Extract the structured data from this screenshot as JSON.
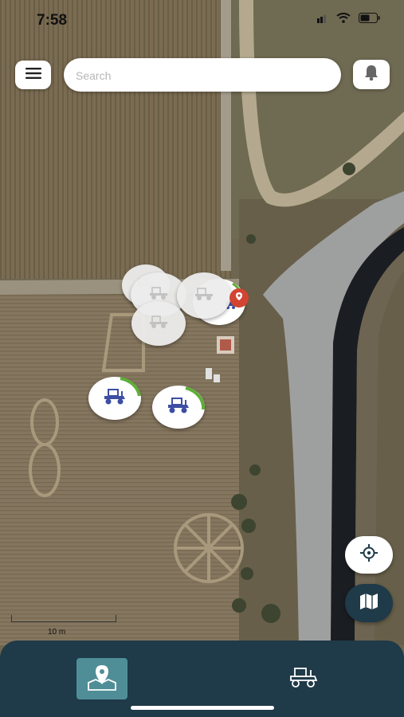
{
  "status_bar": {
    "time": "7:58",
    "icons": [
      "cellular-icon",
      "wifi-icon",
      "battery-icon"
    ]
  },
  "header": {
    "menu_icon": "menu-icon",
    "search_placeholder": "Search",
    "notification_icon": "bell-icon"
  },
  "map": {
    "scale_label": "10 m",
    "markers": [
      {
        "name": "tractor-marker-1",
        "icon": "tractor-icon",
        "state": "active",
        "progress": 0.3
      },
      {
        "name": "tractor-marker-2",
        "icon": "tractor-icon",
        "state": "active",
        "progress": 0.3
      },
      {
        "name": "tractor-cluster",
        "icon": "tractor-icon",
        "state": "inactive"
      }
    ],
    "alert_pin_icon": "alert-pin-icon"
  },
  "controls": {
    "locate_icon": "crosshair-icon",
    "layers_icon": "map-layers-icon"
  },
  "tabbar": {
    "tabs": [
      {
        "name": "tab-map",
        "icon": "map-pin-icon",
        "selected": true
      },
      {
        "name": "tab-fleet",
        "icon": "tractor-icon",
        "selected": false
      }
    ]
  },
  "colors": {
    "navy": "#1f3a48",
    "teal": "#4f8e97",
    "tractor_blue": "#3d4fa3",
    "progress_green": "#5fae3a",
    "alert_red": "#d24432"
  }
}
